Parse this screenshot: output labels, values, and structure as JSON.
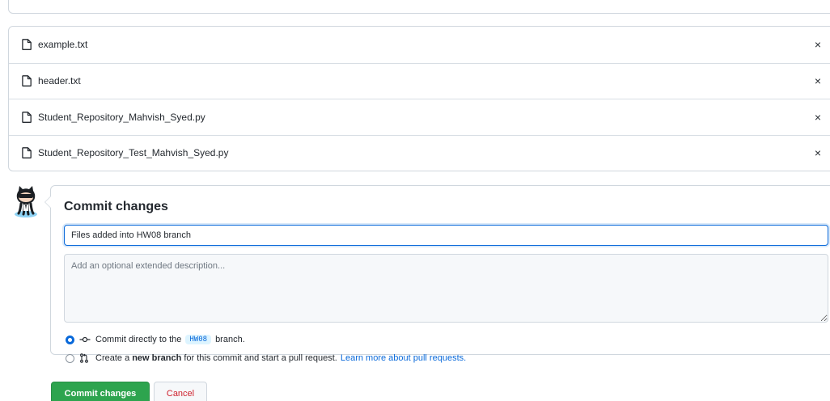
{
  "files": [
    {
      "name": "example.txt"
    },
    {
      "name": "header.txt"
    },
    {
      "name": "Student_Repository_Mahvish_Syed.py"
    },
    {
      "name": "Student_Repository_Test_Mahvish_Syed.py"
    }
  ],
  "remove_glyph": "×",
  "commit": {
    "title": "Commit changes",
    "summary_value": "Files added into HW08 branch",
    "description_placeholder": "Add an optional extended description...",
    "option_direct": {
      "prefix": "Commit directly to the",
      "branch": "HW08",
      "suffix": "branch."
    },
    "option_new": {
      "prefix": "Create a",
      "bold": "new branch",
      "suffix": "for this commit and start a pull request.",
      "link": "Learn more about pull requests."
    },
    "submit_label": "Commit changes",
    "cancel_label": "Cancel"
  },
  "colors": {
    "accent": "#0969da",
    "primary_button": "#2da44e",
    "danger_text": "#cf222e",
    "border": "#d0d7de"
  },
  "icons": {
    "file": "file-icon",
    "commit": "git-commit-icon",
    "pull_request": "git-pull-request-icon",
    "avatar": "octocat-avatar"
  }
}
